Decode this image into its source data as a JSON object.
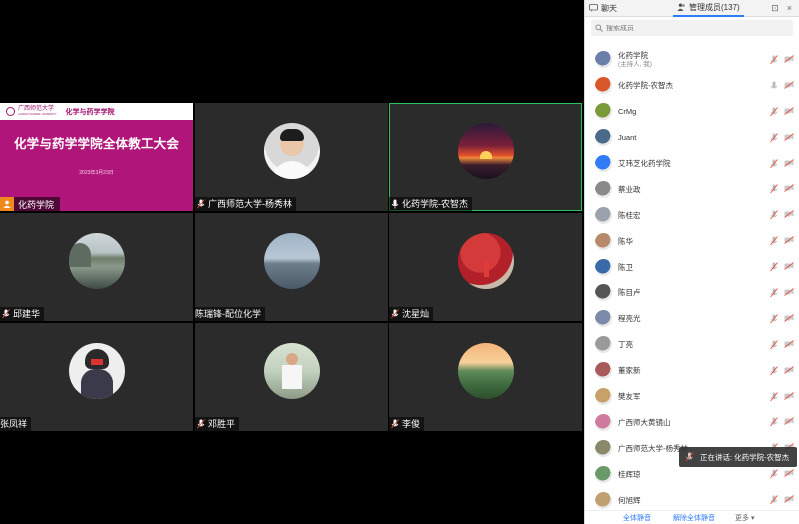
{
  "slide": {
    "logo_text": "广西师范大学",
    "logo_sub": "GUANGXI NORMAL UNIVERSITY",
    "brand": "化学与药学学院",
    "title": "化学与药学学院全体教工大会",
    "date": "2023年3月23日",
    "host_label": "化药学院"
  },
  "tiles": [
    {
      "name": "广西师范大学-杨秀林"
    },
    {
      "name": "化药学院-农智杰"
    },
    {
      "name": "邱建华"
    },
    {
      "name": "陈瑞锋-配位化学"
    },
    {
      "name": "沈星灿"
    },
    {
      "name": "张凤祥"
    },
    {
      "name": "邓胜平"
    },
    {
      "name": "李俊"
    }
  ],
  "panel": {
    "tab_chat": "聊天",
    "tab_members": "管理成员(137)",
    "tools_pin": "⊡",
    "tools_close": "×",
    "search_placeholder": "搜索成员",
    "members": [
      {
        "name": "化药学院",
        "sub": "(主持人, 我)"
      },
      {
        "name": "化药学院-农智杰",
        "sub": ""
      },
      {
        "name": "CrMg",
        "sub": ""
      },
      {
        "name": "Juant",
        "sub": ""
      },
      {
        "name": "艾玮芝化药学院",
        "sub": ""
      },
      {
        "name": "蔡业政",
        "sub": ""
      },
      {
        "name": "陈桂宏",
        "sub": ""
      },
      {
        "name": "陈华",
        "sub": ""
      },
      {
        "name": "陈卫",
        "sub": ""
      },
      {
        "name": "陈目卢",
        "sub": ""
      },
      {
        "name": "程亮光",
        "sub": ""
      },
      {
        "name": "丁亮",
        "sub": ""
      },
      {
        "name": "董家新",
        "sub": ""
      },
      {
        "name": "樊友军",
        "sub": ""
      },
      {
        "name": "广西师大黄镜山",
        "sub": ""
      },
      {
        "name": "广西师范大学-杨秀林",
        "sub": ""
      },
      {
        "name": "桂辉琼",
        "sub": ""
      },
      {
        "name": "何旭辉",
        "sub": ""
      }
    ],
    "mute_all": "全体静音",
    "unmute_all": "解除全体静音",
    "more": "更多 ▾"
  },
  "speaking": "正在讲话: 化药学院-农智杰",
  "colors": {
    "accent": "#2f7cf6",
    "slide": "#b0157a",
    "active_border": "#2bbf5a",
    "host_badge": "#f08a1c"
  }
}
